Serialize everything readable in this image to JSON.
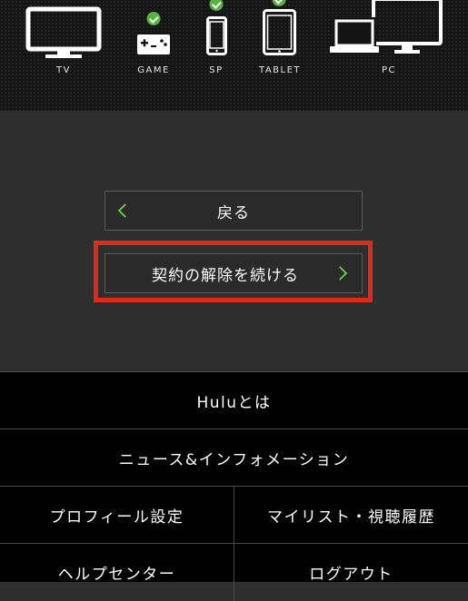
{
  "devices": [
    {
      "label": "TV",
      "icon": "tv-icon",
      "checked": false
    },
    {
      "label": "GAME",
      "icon": "game-controller-icon",
      "checked": true
    },
    {
      "label": "SP",
      "icon": "smartphone-icon",
      "checked": true
    },
    {
      "label": "TABLET",
      "icon": "tablet-icon",
      "checked": true
    },
    {
      "label": "PC",
      "icon": "pc-icon",
      "checked": false
    }
  ],
  "actions": {
    "back_label": "戻る",
    "continue_label": "契約の解除を続ける"
  },
  "menu": {
    "about": "Huluとは",
    "news": "ニュース&インフォメーション",
    "profile": "プロフィール設定",
    "mylist": "マイリスト・視聴履歴",
    "help": "ヘルプセンター",
    "logout": "ログアウト"
  },
  "colors": {
    "accent_green": "#6dbf45",
    "highlight_red": "#e02a19",
    "background": "#2e2e2e",
    "menu_background": "#000000"
  }
}
